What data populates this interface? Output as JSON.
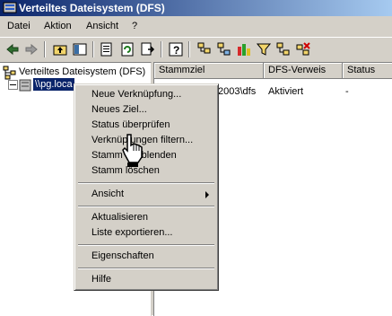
{
  "window": {
    "title": "Verteiltes Dateisystem (DFS)"
  },
  "menu": [
    "Datei",
    "Aktion",
    "Ansicht",
    "?"
  ],
  "toolbar": {
    "icons": [
      "back-icon",
      "forward-icon",
      "up-folder-icon",
      "show-hide-tree-icon",
      "properties-icon",
      "refresh-icon",
      "export-list-icon",
      "help-icon",
      "new-root-icon",
      "new-link-icon",
      "status-icon",
      "filter-icon",
      "add-target-icon",
      "delete-icon"
    ]
  },
  "tree": {
    "root_label": "Verteiltes Dateisystem (DFS)",
    "child_label": "\\\\pg.loca"
  },
  "list": {
    "columns": [
      "Stammziel",
      "DFS-Verweis",
      "Status"
    ],
    "rows": [
      {
        "target": "2003\\dfs",
        "referral": "Aktiviert",
        "status": "-"
      }
    ]
  },
  "context_menu": {
    "items": [
      "Neue Verknüpfung...",
      "Neues Ziel...",
      "Status überprüfen",
      "Verknüpfungen filtern...",
      "Stamm ausblenden",
      "Stamm löschen",
      "Ansicht",
      "Aktualisieren",
      "Liste exportieren...",
      "Eigenschaften",
      "Hilfe"
    ]
  },
  "colors": {
    "title_start": "#0a246a",
    "title_end": "#a6caf0",
    "face": "#d4d0c8"
  }
}
